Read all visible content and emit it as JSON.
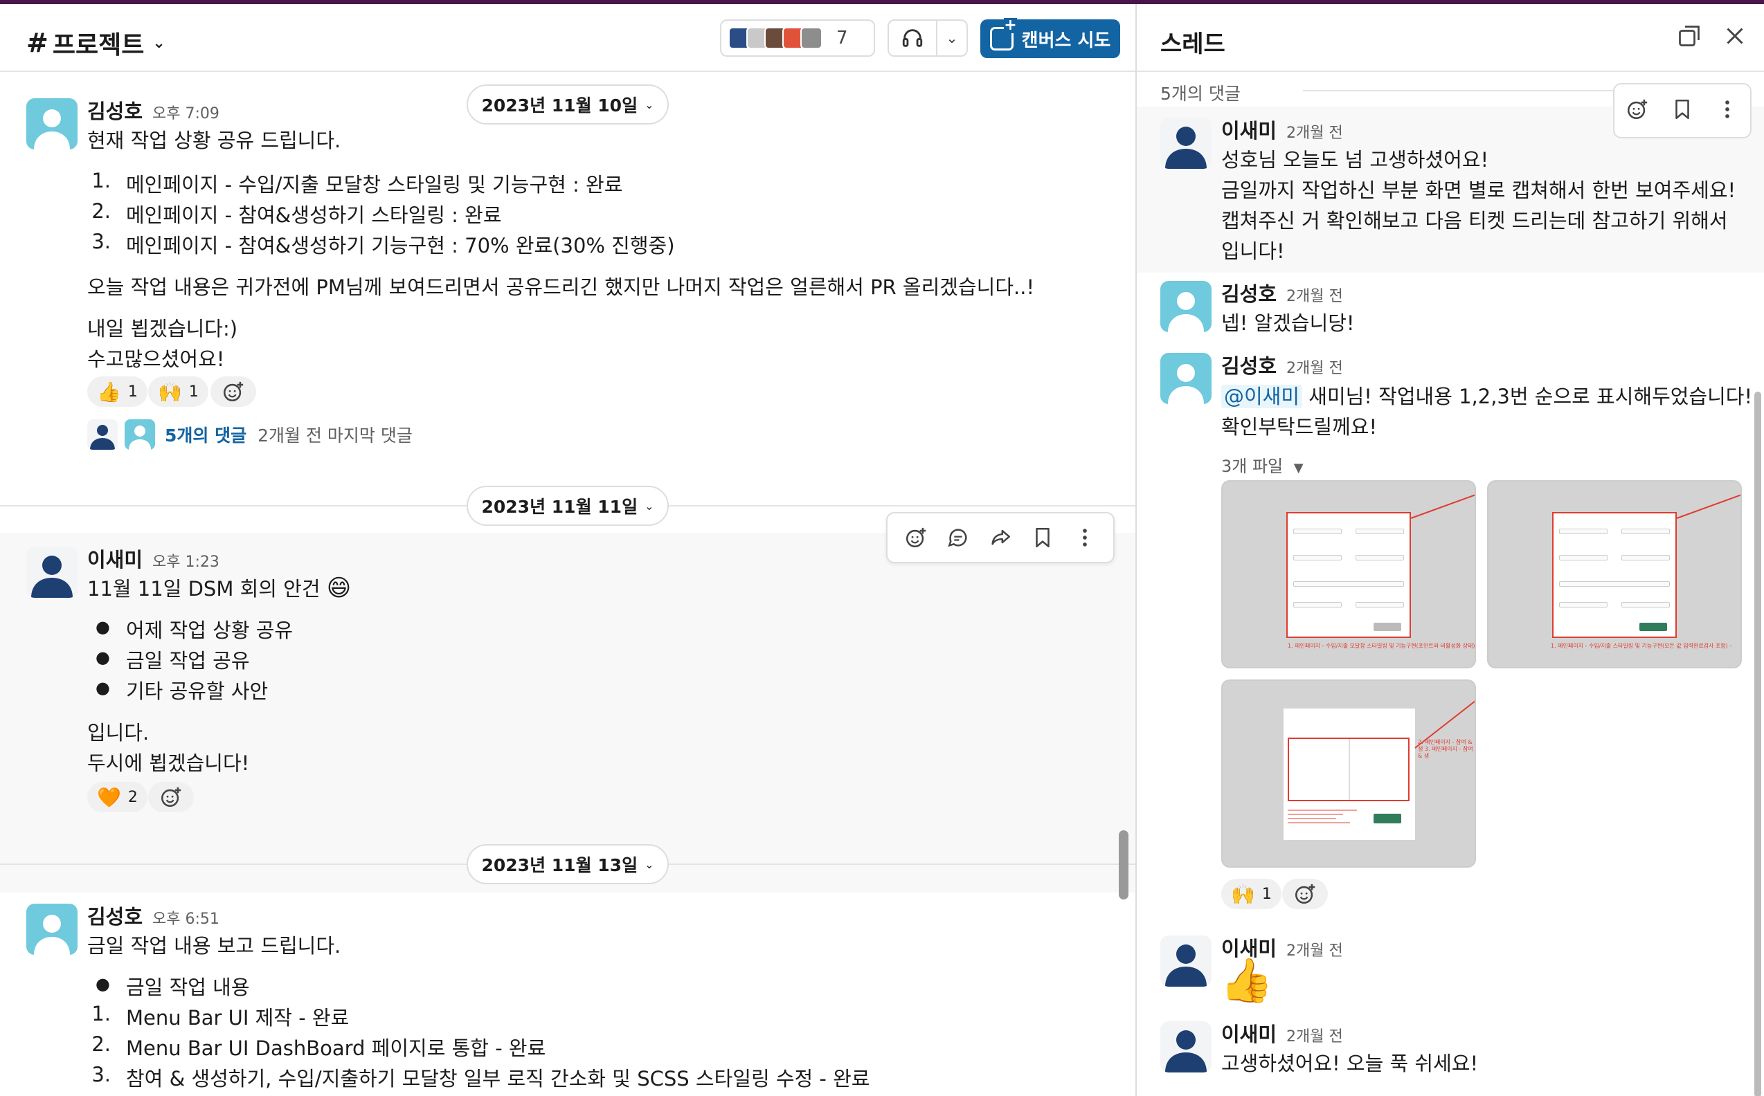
{
  "channel": {
    "title": "프로젝트",
    "member_count": "7",
    "canvas_button": "캔버스 시도"
  },
  "dates": {
    "d1": "2023년 11월 10일",
    "d2": "2023년 11월 11일",
    "d3": "2023년 11월 13일"
  },
  "msg1": {
    "author": "김성호",
    "time": "오후 7:09",
    "intro": "현재 작업 상황 공유 드립니다.",
    "items": [
      "메인페이지 - 수입/지출 모달창 스타일링 및 기능구현 : 완료",
      "메인페이지 - 참여&생성하기 스타일링 : 완료",
      "메인페이지 - 참여&생성하기 기능구현 : 70% 완료(30% 진행중)"
    ],
    "para": "오늘 작업 내용은 귀가전에 PM님께 보여드리면서 공유드리긴 했지만 나머지 작업은 얼른해서 PR 올리겠습니다..!",
    "line1": "내일 뵙겠습니다:)",
    "line2": "수고많으셨어요!",
    "reactions": [
      {
        "emoji": "👍",
        "count": "1"
      },
      {
        "emoji": "🙌",
        "count": "1"
      }
    ],
    "replies_link": "5개의 댓글",
    "replies_meta": "2개월 전 마지막 댓글"
  },
  "msg2": {
    "author": "이새미",
    "time": "오후 1:23",
    "intro": "11월 11일 DSM 회의 안건",
    "intro_emoji": "😄",
    "bullets": [
      "어제 작업 상황 공유",
      "금일 작업 공유",
      "기타 공유할 사안"
    ],
    "line1": "입니다.",
    "line2": "두시에 뵙겠습니다!",
    "reaction": {
      "emoji": "🧡",
      "count": "2"
    }
  },
  "msg3": {
    "author": "김성호",
    "time": "오후 6:51",
    "intro": "금일 작업 내용 보고 드립니다.",
    "bullet": "금일 작업 내용",
    "items": [
      "Menu Bar UI 제작 - 완료",
      "Menu Bar UI DashBoard 페이지로 통합 - 완료",
      "참여 & 생성하기, 수입/지출하기 모달창 일부 로직 간소화 및 SCSS 스타일링 수정 - 완료"
    ]
  },
  "thread": {
    "title": "스레드",
    "replies_count": "5개의 댓글",
    "replies": [
      {
        "author": "이새미",
        "time": "2개월 전",
        "lines": [
          "성호님 오늘도 넘 고생하셨어요!",
          "금일까지 작업하신 부분 화면 별로 캡쳐해서 한번 보여주세요!",
          "캡쳐주신 거 확인해보고 다음 티켓 드리는데 참고하기 위해서",
          "입니다!"
        ]
      },
      {
        "author": "김성호",
        "time": "2개월 전",
        "lines": [
          "넵! 알겠습니당!"
        ]
      },
      {
        "author": "김성호",
        "time": "2개월 전",
        "mention": "@이새미",
        "line1_rest": " 새미님! 작업내용 1,2,3번 순으로 표시해두었습니다!",
        "line2": "확인부탁드릴께요!",
        "files_label": "3개 파일",
        "reaction": {
          "emoji": "🙌",
          "count": "1"
        },
        "file_captions": [
          "1. 메인페이지 - 수입/지출 모달창 스타일링 및 기능구현(포인트와 비활성화 상태) -",
          "1. 메인페이지 - 수입/지출 스타일링 및 기능구현(모든 값 입력완료검사 포함) -",
          "2. 메인페이지 - 참여 & 생 3. 메인페이지 - 참여 & 생"
        ]
      },
      {
        "author": "이새미",
        "time": "2개월 전",
        "emoji": "👍"
      },
      {
        "author": "이새미",
        "time": "2개월 전",
        "lines": [
          "고생하셨어요! 오늘 푹 쉬세요!"
        ]
      }
    ]
  },
  "colors": {
    "accent": "#1264a3",
    "workspace": "#4a154b",
    "avatar_teal": "#6ecadc",
    "avatar_navy": "#1d3f72"
  }
}
